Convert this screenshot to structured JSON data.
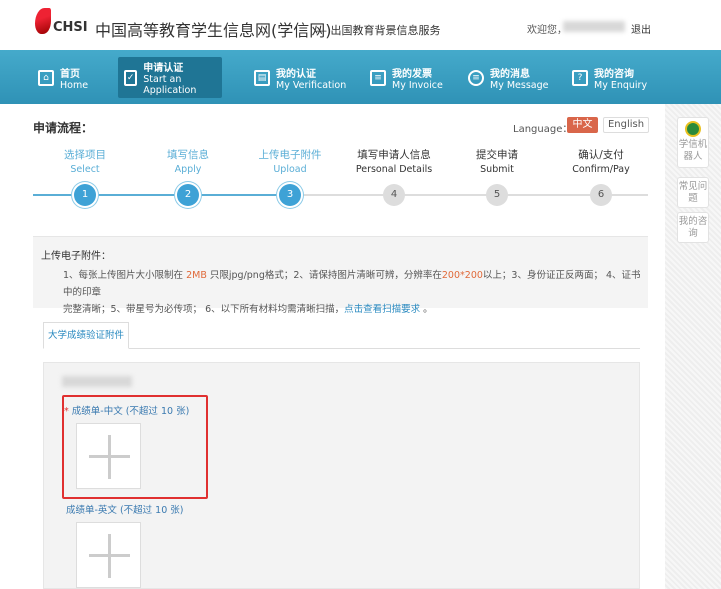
{
  "header": {
    "logo_text": "CHSI",
    "site_title": "中国高等教育学生信息网(学信网)",
    "subtitle": "— 出国教育背景信息服务",
    "welcome": "欢迎您，",
    "logout": "退出"
  },
  "nav": [
    {
      "cn": "首页",
      "en": "Home",
      "icon": "home-icon"
    },
    {
      "cn": "申请认证",
      "en": "Start an Application",
      "icon": "checkbox-icon",
      "active": true
    },
    {
      "cn": "我的认证",
      "en": "My Verification",
      "icon": "verification-icon"
    },
    {
      "cn": "我的发票",
      "en": "My Invoice",
      "icon": "invoice-icon"
    },
    {
      "cn": "我的消息",
      "en": "My Message",
      "icon": "message-icon"
    },
    {
      "cn": "我的咨询",
      "en": "My Enquiry",
      "icon": "enquiry-icon"
    }
  ],
  "process": {
    "title": "申请流程：",
    "language_label": "Language：",
    "lang_cn": "中文",
    "lang_en": "English",
    "steps": [
      {
        "cn": "选择项目",
        "en": "Select",
        "num": "1"
      },
      {
        "cn": "填写信息",
        "en": "Apply",
        "num": "2"
      },
      {
        "cn": "上传电子附件",
        "en": "Upload",
        "num": "3"
      },
      {
        "cn": "填写申请人信息",
        "en": "Personal Details",
        "num": "4"
      },
      {
        "cn": "提交申请",
        "en": "Submit",
        "num": "5"
      },
      {
        "cn": "确认/支付",
        "en": "Confirm/Pay",
        "num": "6"
      }
    ],
    "current_step": 3
  },
  "notice": {
    "title": "上传电子附件：",
    "p1": "1、每张上传图片大小限制在 ",
    "size": "2MB",
    "p2": " 只限jpg/png格式；2、请保持图片清晰可辨，分辨率在",
    "res": "200*200",
    "p3": "以上；3、身份证正反两面； 4、证书中的印章",
    "p4": "完整清晰；5、带星号为必传项； 6、以下所有材料均需清晰扫描，",
    "link": "点击查看扫描要求",
    "p5": " 。"
  },
  "tab": "大学成绩验证附件",
  "uploads": [
    {
      "required": "*",
      "label": "成绩单-中文 (不超过 10 张)"
    },
    {
      "label": "成绩单-英文 (不超过 10 张)"
    }
  ],
  "sidebar": [
    {
      "label": "学信机器人"
    },
    {
      "label": "常见问题"
    },
    {
      "label": "我的咨询"
    }
  ],
  "colors": {
    "nav": "#3a9ec2",
    "accent": "#d9664a",
    "step": "#3ea2d6"
  }
}
